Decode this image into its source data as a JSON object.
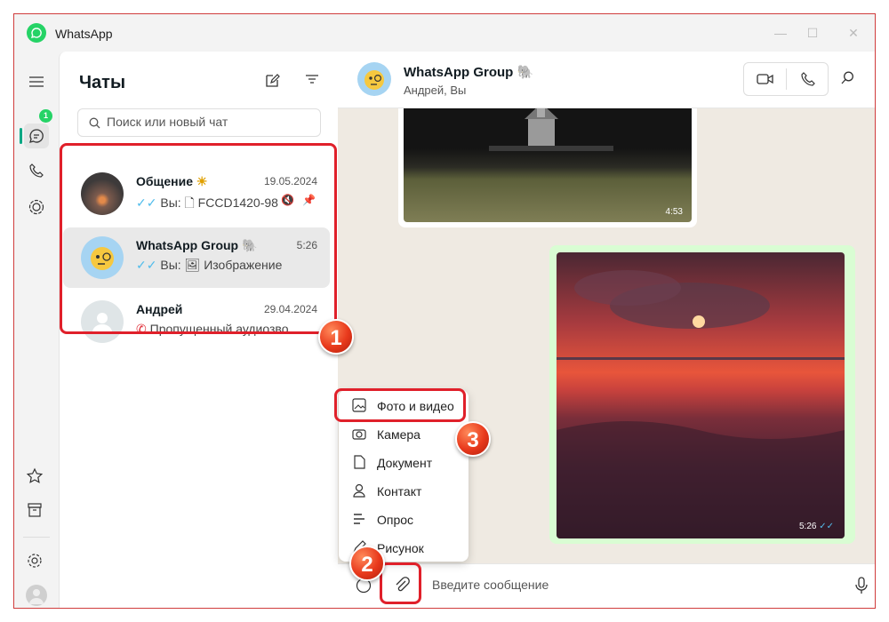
{
  "app": {
    "title": "WhatsApp",
    "accent": "#25d366"
  },
  "sidebar": {
    "title": "Чаты",
    "search_placeholder": "Поиск или новый чат",
    "unread_count": "1"
  },
  "chats": [
    {
      "name": "Общение",
      "emoji": "☀",
      "time": "19.05.2024",
      "preview": "Вы: 🗋 FCCD1420-98...",
      "selected": false
    },
    {
      "name": "WhatsApp Group",
      "emoji": "🐘",
      "time": "5:26",
      "preview": "Вы: 🖼 Изображение",
      "selected": true
    },
    {
      "name": "Андрей",
      "emoji": "",
      "time": "29.04.2024",
      "preview": "Пропущенный аудиозво...",
      "selected": false
    }
  ],
  "conversation": {
    "name": "WhatsApp Group",
    "name_emoji": "🐘",
    "subtitle": "Андрей, Вы",
    "msg1_time": "4:53",
    "msg2_time": "5:26",
    "input_placeholder": "Введите сообщение"
  },
  "attach_menu": {
    "items": [
      "Фото и видео",
      "Камера",
      "Документ",
      "Контакт",
      "Опрос",
      "Рисунок"
    ]
  },
  "steps": [
    "1",
    "2",
    "3"
  ]
}
